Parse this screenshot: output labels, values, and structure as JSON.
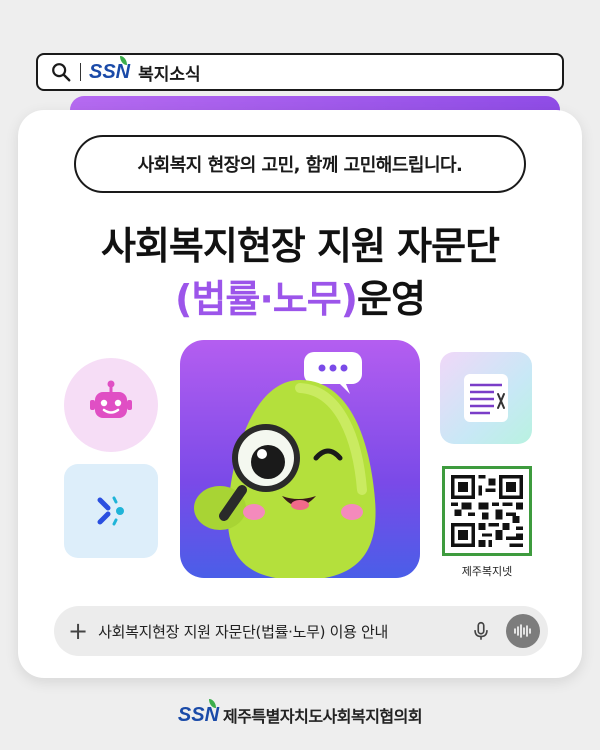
{
  "search": {
    "logo": "SSN",
    "query": "복지소식"
  },
  "card": {
    "tagline": "사회복지 현장의 고민, 함께 고민해드립니다.",
    "title_line1": "사회복지현장 지원 자문단",
    "title_line2_accent": "(법률·노무)",
    "title_line2_rest": "운영",
    "qr_label": "제주복지넷",
    "chat_input": "사회복지현장 지원 자문단(법률·노무) 이용 안내",
    "chat_plus": "+"
  },
  "footer": {
    "logo": "SSN",
    "org_name": "제주특별자치도사회복지협의회"
  },
  "icons": {
    "search": "search-icon",
    "robot": "robot-icon",
    "sparkle": "sparkle-icon",
    "document": "document-icon",
    "qr": "qr-code",
    "mic": "mic-icon",
    "voice": "voice-wave-icon",
    "chat": "chat-bubble-icon"
  },
  "colors": {
    "accent_purple": "#9c55ea",
    "brand_blue": "#1a4aa8",
    "brand_green": "#3cae4c",
    "character_green": "#b4e03c"
  }
}
